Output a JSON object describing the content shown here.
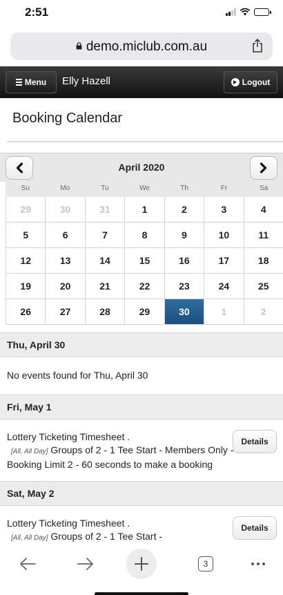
{
  "status_bar": {
    "time": "2:51"
  },
  "browser": {
    "url": "demo.miclub.com.au",
    "tab_count": "3"
  },
  "header": {
    "menu_label": "Menu",
    "user_name": "Elly Hazell",
    "logout_label": "Logout"
  },
  "page": {
    "title": "Booking Calendar"
  },
  "calendar": {
    "month_label": "April 2020",
    "weekdays": [
      "Su",
      "Mo",
      "Tu",
      "We",
      "Th",
      "Fr",
      "Sa"
    ],
    "weeks": [
      [
        "29",
        "30",
        "31",
        "1",
        "2",
        "3",
        "4"
      ],
      [
        "5",
        "6",
        "7",
        "8",
        "9",
        "10",
        "11"
      ],
      [
        "12",
        "13",
        "14",
        "15",
        "16",
        "17",
        "18"
      ],
      [
        "19",
        "20",
        "21",
        "22",
        "23",
        "24",
        "25"
      ],
      [
        "26",
        "27",
        "28",
        "29",
        "30",
        "1",
        "2"
      ]
    ],
    "selected_day": "30"
  },
  "events": {
    "day1_heading": "Thu, April 30",
    "day1_message": "No events found for Thu, April 30",
    "day2_heading": "Fri, May 1",
    "day2_event_title": "Lottery Ticketing Timesheet .",
    "day2_event_tag": "[All, All Day]",
    "day2_event_desc": "Groups of 2 - 1 Tee Start - Members Only - Member Booking Limit 2 - 60 seconds to make a booking",
    "day3_heading": "Sat, May 2",
    "day3_event_title": "Lottery Ticketing Timesheet .",
    "day3_event_tag": "[All, All Day]",
    "day3_event_desc": "Groups of 2 - 1 Tee Start -",
    "details_label": "Details"
  },
  "colors": {
    "selected_day": "#1d4f7d",
    "header_bg": "#111111"
  },
  "icons": [
    "lock-icon",
    "share-icon",
    "hamburger-icon",
    "logout-icon",
    "chevron-left-icon",
    "chevron-right-icon",
    "back-icon",
    "forward-icon",
    "plus-icon",
    "tabs-icon",
    "more-icon"
  ]
}
